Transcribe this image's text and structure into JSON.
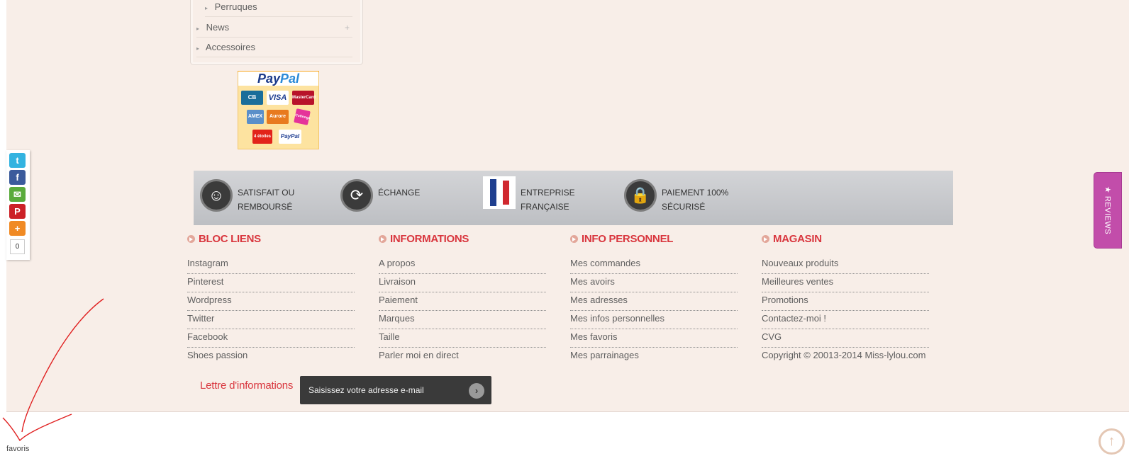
{
  "categories": [
    {
      "label": "Perruques",
      "sub": true,
      "plus": false
    },
    {
      "label": "News",
      "sub": false,
      "plus": true
    },
    {
      "label": "Accessoires",
      "sub": false,
      "plus": false
    }
  ],
  "paypal": {
    "brand_pay": "Pay",
    "brand_pal": "Pal",
    "cards": [
      "CB",
      "VISA",
      "MasterCard",
      "AMEX",
      "Aurore",
      "Cofinoga",
      "4 étoiles",
      "PayPal"
    ]
  },
  "share": {
    "icons": [
      "twitter-icon",
      "facebook-icon",
      "email-icon",
      "pinterest-icon",
      "share-more-icon"
    ],
    "count": "0"
  },
  "reviews": {
    "label": "★ REVIEWS"
  },
  "reassurance": [
    {
      "id": "satisfait",
      "line1": "SATISFAIT OU",
      "line2": "REMBOURSÉ",
      "icon": "smiley-icon"
    },
    {
      "id": "echange",
      "line1": "ÉCHANGE",
      "line2": "",
      "icon": "refresh-icon"
    },
    {
      "id": "entreprise",
      "line1": "ENTREPRISE",
      "line2": "FRANÇAISE",
      "icon": "france-flag-icon"
    },
    {
      "id": "paiement",
      "line1": "PAIEMENT 100%",
      "line2": "SÉCURISÉ",
      "icon": "lock-icon"
    }
  ],
  "footer": {
    "columns": [
      {
        "title": "BLOC LIENS",
        "links": [
          "Instagram",
          "Pinterest",
          "Wordpress",
          "Twitter",
          "Facebook",
          "Shoes passion"
        ]
      },
      {
        "title": "INFORMATIONS",
        "links": [
          "A propos",
          "Livraison",
          "Paiement",
          "Marques",
          "Taille",
          "Parler moi en direct"
        ]
      },
      {
        "title": "INFO PERSONNEL",
        "links": [
          "Mes commandes",
          "Mes avoirs",
          "Mes adresses",
          "Mes infos personnelles",
          "Mes favoris",
          "Mes parrainages"
        ]
      },
      {
        "title": "MAGASIN",
        "links": [
          "Nouveaux produits",
          "Meilleures ventes",
          "Promotions",
          "Contactez-moi !",
          "CVG",
          "Copyright © 20013-2014 Miss-lylou.com"
        ]
      }
    ]
  },
  "newsletter": {
    "label": "Lettre d'informations",
    "placeholder": "Saisissez votre adresse e-mail"
  },
  "annotation": {
    "label": "favoris",
    "color": "#e02020"
  },
  "colors": {
    "accent": "#d9363e",
    "background": "#f8eee8",
    "reviews": "#c24daa"
  }
}
